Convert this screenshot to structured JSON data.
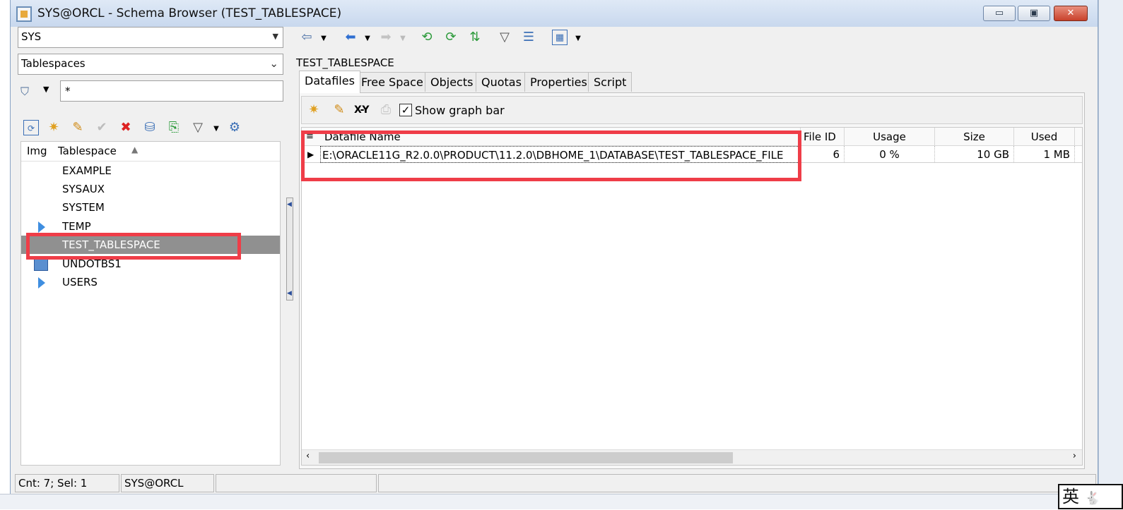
{
  "window": {
    "title": "SYS@ORCL - Schema Browser (TEST_TABLESPACE)",
    "min_glyph": "▭",
    "max_glyph": "▣",
    "close_glyph": "✕"
  },
  "left": {
    "schema_value": "SYS",
    "objtype_value": "Tablespaces",
    "filter_value": "*",
    "tree_header": {
      "img": "Img",
      "name": "Tablespace"
    },
    "items": [
      {
        "label": "EXAMPLE",
        "icon": ""
      },
      {
        "label": "SYSAUX",
        "icon": ""
      },
      {
        "label": "SYSTEM",
        "icon": ""
      },
      {
        "label": "TEMP",
        "icon": "expand-arrow"
      },
      {
        "label": "TEST_TABLESPACE",
        "icon": "",
        "selected": true
      },
      {
        "label": "UNDOTBS1",
        "icon": "undo-icon"
      },
      {
        "label": "USERS",
        "icon": "expand-arrow"
      }
    ]
  },
  "right": {
    "object_name": "TEST_TABLESPACE",
    "tabs": [
      "Datafiles",
      "Free Space",
      "Objects",
      "Quotas",
      "Properties",
      "Script"
    ],
    "active_tab": "Datafiles",
    "show_graph_bar_label": "Show graph bar",
    "xy_label": "X-Y",
    "grid": {
      "columns": [
        "Datafile Name",
        "File ID",
        "Usage",
        "Size",
        "Used"
      ],
      "row": {
        "name": "E:\\ORACLE11G_R2.0.0\\PRODUCT\\11.2.0\\DBHOME_1\\DATABASE\\TEST_TABLESPACE_FILE",
        "file_id": "6",
        "usage": "0 %",
        "size": "10 GB",
        "used": "1 MB"
      }
    }
  },
  "status": {
    "count": "Cnt: 7; Sel: 1",
    "connection": "SYS@ORCL"
  },
  "ime": {
    "label": "英",
    "icon": "rabbit-icon"
  },
  "colors": {
    "annotation": "#ef3d48",
    "selection": "#909090",
    "accent": "#3f8ee0"
  }
}
